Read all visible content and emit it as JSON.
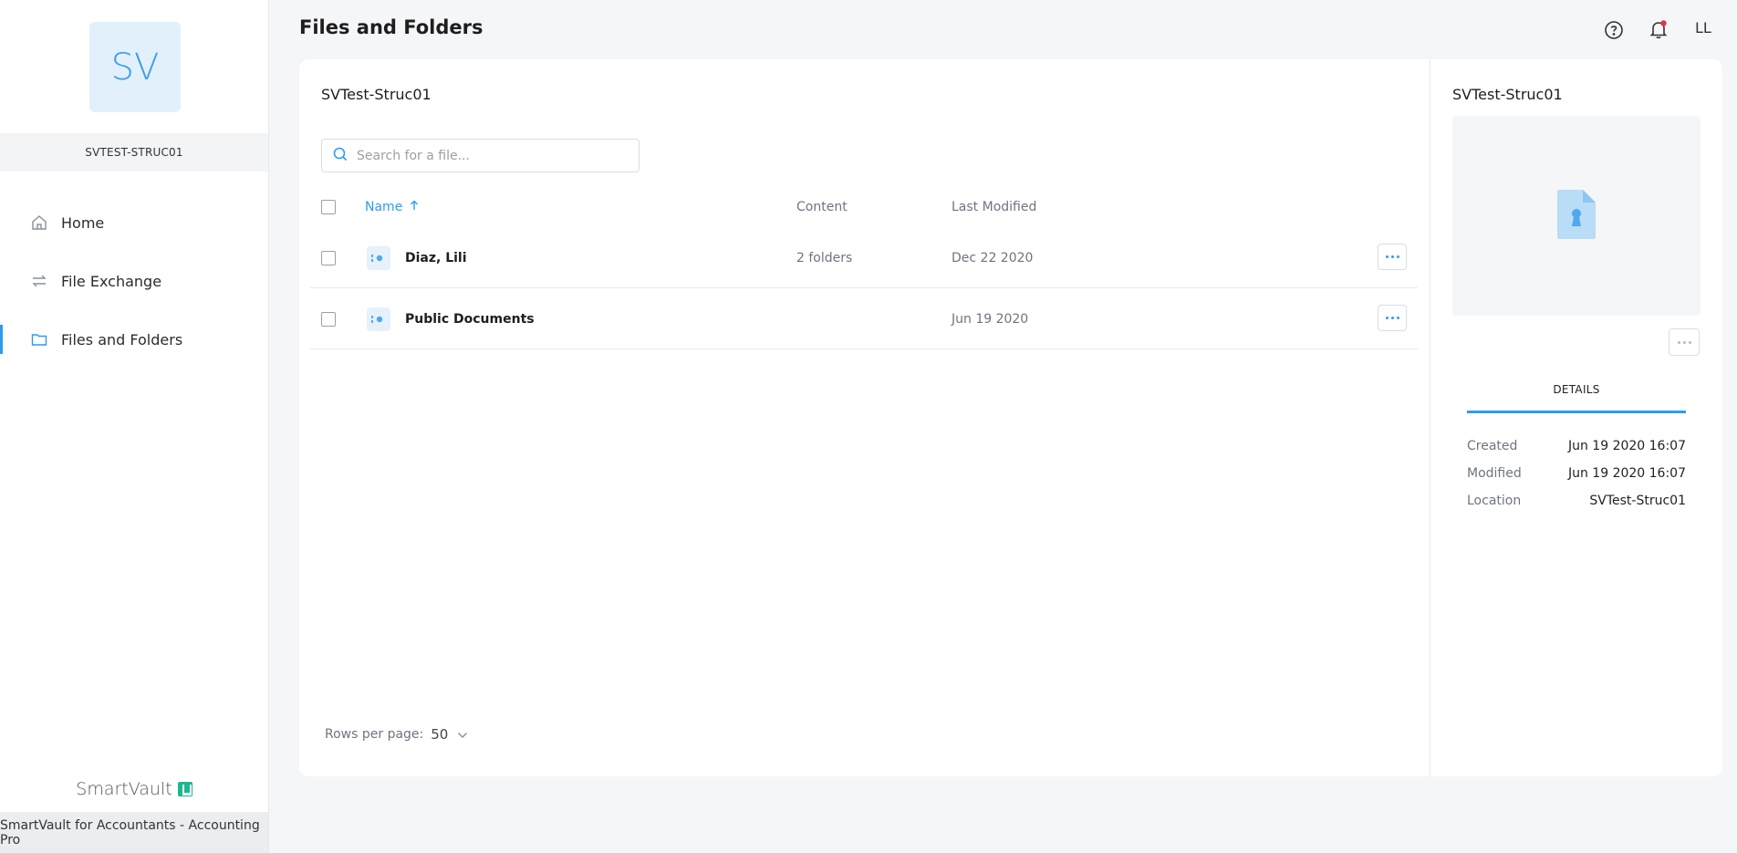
{
  "sidebar": {
    "avatar_initials": "SV",
    "account_name": "SVTEST-STRUC01",
    "items": [
      {
        "label": "Home",
        "icon": "home-icon",
        "active": false
      },
      {
        "label": "File Exchange",
        "icon": "exchange-icon",
        "active": false
      },
      {
        "label": "Files and Folders",
        "icon": "folder-icon",
        "active": true
      }
    ],
    "brand": "SmartVault",
    "footer": "SmartVault for Accountants - Accounting Pro"
  },
  "header": {
    "title": "Files and Folders",
    "user_initials": "LL",
    "icons": [
      "help-icon",
      "notification-bell-icon"
    ]
  },
  "main": {
    "folder_title": "SVTest-Struc01",
    "search": {
      "placeholder": "Search for a file..."
    },
    "columns": {
      "name": "Name",
      "content": "Content",
      "last_modified": "Last Modified"
    },
    "rows": [
      {
        "name": "Diaz, Lili",
        "content": "2 folders",
        "last_modified": "Dec 22 2020"
      },
      {
        "name": "Public Documents",
        "content": "",
        "last_modified": "Jun 19 2020"
      }
    ],
    "pagination": {
      "label": "Rows per page:",
      "value": "50"
    }
  },
  "details_panel": {
    "title": "SVTest-Struc01",
    "tab": "DETAILS",
    "fields": [
      {
        "key": "Created",
        "value": "Jun 19 2020 16:07"
      },
      {
        "key": "Modified",
        "value": "Jun 19 2020 16:07"
      },
      {
        "key": "Location",
        "value": "SVTest-Struc01"
      }
    ]
  },
  "colors": {
    "accent": "#2d9cee",
    "brand_green": "#1db78f",
    "notification_dot": "#e0334d"
  }
}
